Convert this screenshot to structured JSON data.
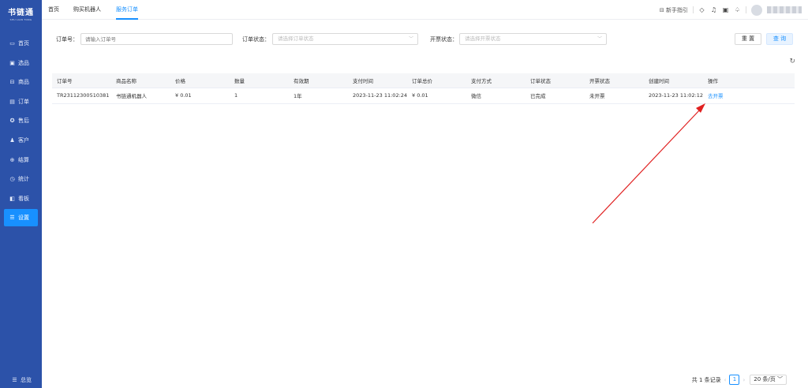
{
  "sidebar": {
    "logo_main": "书链通",
    "logo_sub": "SHU LIAN TONG",
    "items": [
      {
        "label": "首页",
        "icon": "monitor-icon",
        "glyph": "▭"
      },
      {
        "label": "选品",
        "icon": "select-product-icon",
        "glyph": "▣"
      },
      {
        "label": "商品",
        "icon": "goods-icon",
        "glyph": "⊟"
      },
      {
        "label": "订单",
        "icon": "order-icon",
        "glyph": "▤"
      },
      {
        "label": "售后",
        "icon": "after-sale-icon",
        "glyph": "✪"
      },
      {
        "label": "客户",
        "icon": "customer-icon",
        "glyph": "♟"
      },
      {
        "label": "结算",
        "icon": "settlement-icon",
        "glyph": "⊕"
      },
      {
        "label": "统计",
        "icon": "stats-icon",
        "glyph": "◷"
      },
      {
        "label": "看板",
        "icon": "board-icon",
        "glyph": "◧"
      },
      {
        "label": "设置",
        "icon": "settings-icon",
        "glyph": "☰",
        "active": true
      }
    ],
    "footer_label": "总览",
    "footer_glyph": "☰"
  },
  "topbar": {
    "tabs": [
      "首页",
      "购买机器人",
      "服务订单"
    ],
    "active_tab": 2,
    "guide_label": "新手指引",
    "guide_glyph": "⊟",
    "icon_glyphs": [
      "◇",
      "♫",
      "▣",
      "♤"
    ]
  },
  "filters": {
    "order_no_label": "订单号：",
    "order_no_placeholder": "请输入订单号",
    "order_status_label": "订单状态：",
    "order_status_placeholder": "请选择订单状态",
    "invoice_status_label": "开票状态：",
    "invoice_status_placeholder": "请选择开票状态",
    "reset_label": "重 置",
    "query_label": "查 询",
    "chevron": "﹀"
  },
  "refresh_glyph": "↻",
  "table": {
    "headers": [
      "订单号",
      "商品名称",
      "价格",
      "数量",
      "有效期",
      "支付时间",
      "订单总价",
      "支付方式",
      "订单状态",
      "开票状态",
      "创建时间",
      "操作"
    ],
    "rows": [
      {
        "order_no": "TR23112300510381",
        "product": "书链通机器人",
        "price": "¥ 0.01",
        "qty": "1",
        "validity": "1年",
        "pay_time": "2023-11-23 11:02:24",
        "total": "¥ 0.01",
        "pay_method": "微信",
        "order_status": "已完成",
        "invoice_status": "未开票",
        "created": "2023-11-23 11:02:12",
        "action": "去开票"
      }
    ]
  },
  "pagination": {
    "total_text": "共 1 条记录",
    "prev": "‹",
    "current_page": "1",
    "next": "›",
    "page_size": "20 条/页 ﹀"
  },
  "annotation": {
    "color": "#e02020"
  },
  "colors": {
    "sidebar": "#2c52a9",
    "accent": "#1890ff"
  }
}
